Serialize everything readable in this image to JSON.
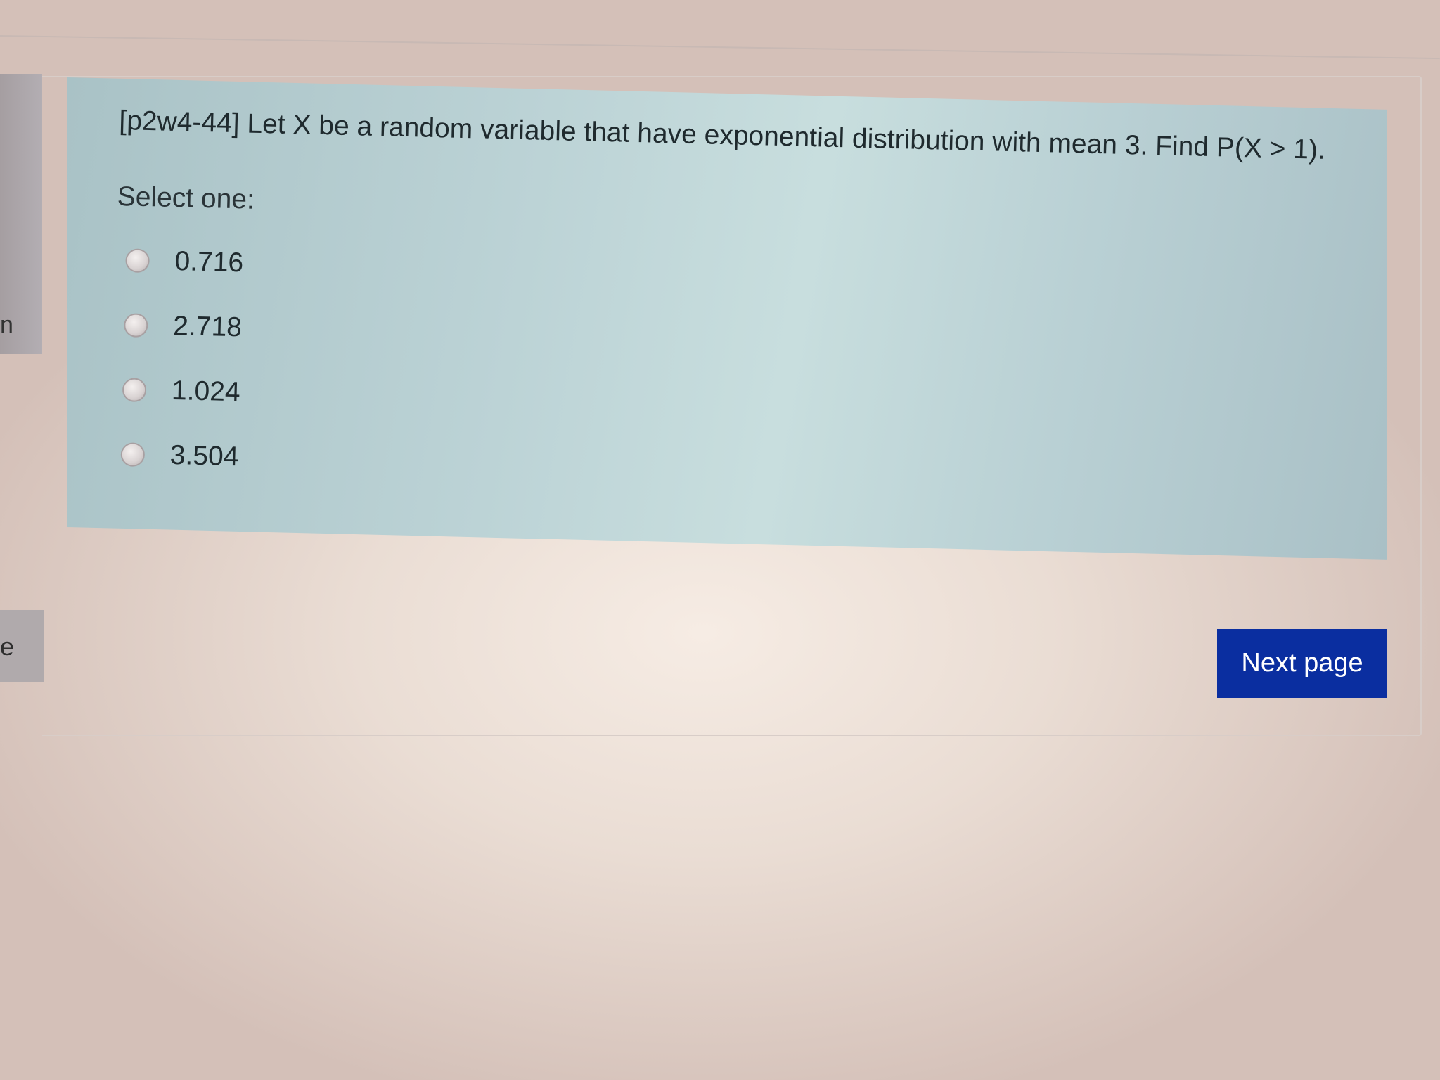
{
  "sidebar": {
    "upper_tab_fragment": "n",
    "lower_tab_fragment": "e"
  },
  "question": {
    "text": "[p2w4-44] Let X be a random variable that have exponential distribution with mean 3. Find P(X > 1).",
    "prompt": "Select one:",
    "options": [
      {
        "label": "0.716",
        "selected": false
      },
      {
        "label": "2.718",
        "selected": false
      },
      {
        "label": "1.024",
        "selected": false
      },
      {
        "label": "3.504",
        "selected": false
      }
    ]
  },
  "navigation": {
    "next_label": "Next page"
  },
  "colors": {
    "question_background": "#bcd3d6",
    "next_button": "#0a2ea0"
  }
}
